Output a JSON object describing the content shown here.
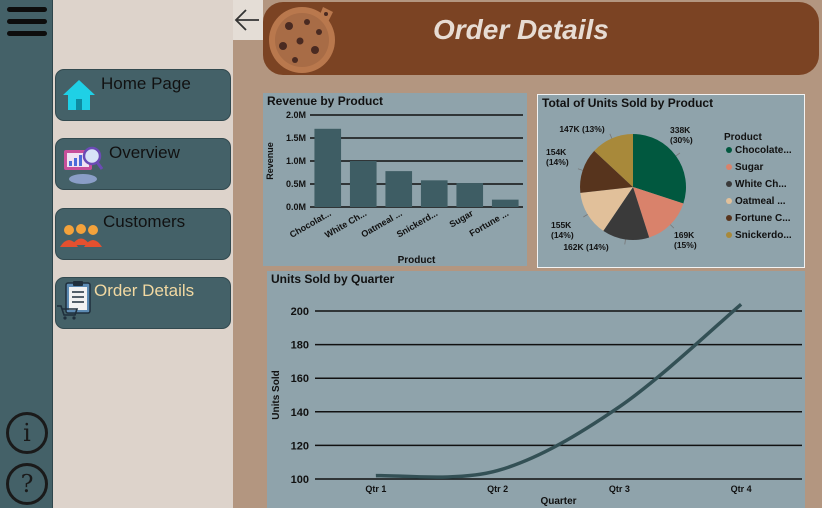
{
  "header": {
    "title": "Order Details"
  },
  "nav": {
    "items": [
      {
        "label": "Home Page",
        "icon": "home-icon"
      },
      {
        "label": "Overview",
        "icon": "analytics-icon"
      },
      {
        "label": "Customers",
        "icon": "customers-icon"
      },
      {
        "label": "Order Details",
        "icon": "order-clipboard-icon",
        "active": true
      }
    ]
  },
  "rail": {
    "info_symbol": "i",
    "help_symbol": "?"
  },
  "colors": {
    "accent": "#446168",
    "header": "#7b4323",
    "active_nav_text": "#f2d9a2",
    "chart_bg": "#8fa3ab",
    "bar": "#3e5d64",
    "line": "#335055"
  },
  "charts": {
    "revenue": {
      "chart_data": {
        "type": "bar",
        "title": "Revenue by Product",
        "xlabel": "Product",
        "ylabel": "Revenue",
        "categories": [
          "Chocolat...",
          "White Ch...",
          "Oatmeal ...",
          "Snickerd...",
          "Sugar",
          "Fortune ..."
        ],
        "values": [
          1700000,
          1000000,
          780000,
          580000,
          520000,
          160000
        ],
        "yticks": [
          "0.0M",
          "0.5M",
          "1.0M",
          "1.5M",
          "2.0M"
        ],
        "ylim": [
          0,
          2000000
        ],
        "grid": true
      }
    },
    "units": {
      "chart_data": {
        "type": "pie",
        "title": "Total of Units Sold by Product",
        "legend_title": "Product",
        "legend_position": "right",
        "slices": [
          {
            "label": "Chocolate...",
            "value": 338,
            "display": "338K",
            "pct": "(30%)",
            "color": "#01583f"
          },
          {
            "label": "Sugar",
            "value": 169,
            "display": "169K",
            "pct": "(15%)",
            "color": "#d9826b"
          },
          {
            "label": "White Ch...",
            "value": 162,
            "display": "162K (14%)",
            "pct": "",
            "color": "#3a3a3a"
          },
          {
            "label": "Oatmeal ...",
            "value": 155,
            "display": "155K",
            "pct": "(14%)",
            "color": "#e1c09a"
          },
          {
            "label": "Fortune C...",
            "value": 154,
            "display": "154K",
            "pct": "(14%)",
            "color": "#57341d"
          },
          {
            "label": "Snickerdo...",
            "value": 147,
            "display": "147K (13%)",
            "pct": "",
            "color": "#a8893a"
          }
        ]
      }
    },
    "quarter": {
      "chart_data": {
        "type": "line",
        "title": "Units Sold by Quarter",
        "xlabel": "Quarter",
        "ylabel": "Units Sold",
        "categories": [
          "Qtr 1",
          "Qtr 2",
          "Qtr 3",
          "Qtr 4"
        ],
        "values": [
          102,
          105,
          143,
          204
        ],
        "yticks": [
          100,
          120,
          140,
          160,
          180,
          200
        ],
        "ylim": [
          100,
          200
        ],
        "grid": true
      }
    }
  }
}
